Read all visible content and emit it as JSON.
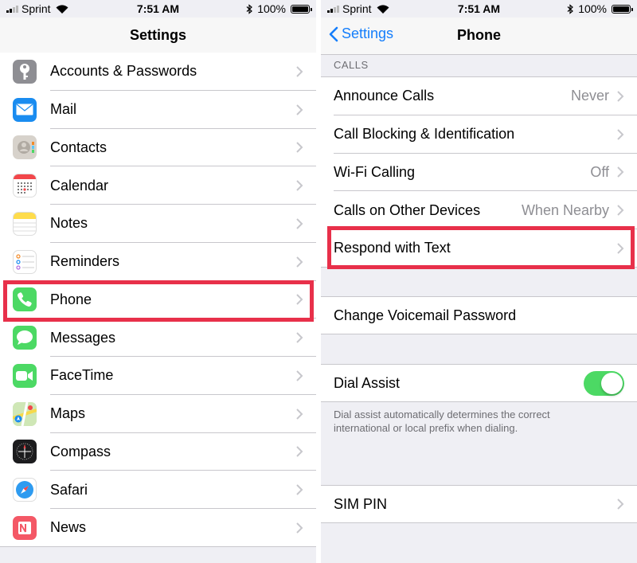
{
  "status_bar": {
    "carrier": "Sprint",
    "time": "7:51 AM",
    "battery": "100%"
  },
  "left": {
    "title": "Settings",
    "items": [
      {
        "label": "Accounts & Passwords",
        "icon": "key-icon",
        "color": "#8e8e93"
      },
      {
        "label": "Mail",
        "icon": "mail-icon",
        "color": "#1a8cf0"
      },
      {
        "label": "Contacts",
        "icon": "contacts-icon",
        "color": "#c9c4bd"
      },
      {
        "label": "Calendar",
        "icon": "calendar-icon",
        "color": "#ffffff"
      },
      {
        "label": "Notes",
        "icon": "notes-icon",
        "color": "#fedc4c"
      },
      {
        "label": "Reminders",
        "icon": "reminders-icon",
        "color": "#ffffff"
      },
      {
        "label": "Phone",
        "icon": "phone-icon",
        "color": "#4cd964"
      },
      {
        "label": "Messages",
        "icon": "messages-icon",
        "color": "#4cd964"
      },
      {
        "label": "FaceTime",
        "icon": "facetime-icon",
        "color": "#4cd964"
      },
      {
        "label": "Maps",
        "icon": "maps-icon",
        "color": "#7dc96d"
      },
      {
        "label": "Compass",
        "icon": "compass-icon",
        "color": "#1c1c1e"
      },
      {
        "label": "Safari",
        "icon": "safari-icon",
        "color": "#ffffff"
      },
      {
        "label": "News",
        "icon": "news-icon",
        "color": "#f45866"
      }
    ]
  },
  "right": {
    "back_label": "Settings",
    "title": "Phone",
    "calls_header": "CALLS",
    "calls": [
      {
        "label": "Announce Calls",
        "value": "Never"
      },
      {
        "label": "Call Blocking & Identification",
        "value": ""
      },
      {
        "label": "Wi-Fi Calling",
        "value": "Off"
      },
      {
        "label": "Calls on Other Devices",
        "value": "When Nearby"
      },
      {
        "label": "Respond with Text",
        "value": ""
      }
    ],
    "voicemail_link": "Change Voicemail Password",
    "dial_assist": {
      "label": "Dial Assist",
      "on": true,
      "footnote_line1": "Dial assist automatically determines the correct",
      "footnote_line2": "international or local prefix when dialing."
    },
    "sim_pin": "SIM PIN"
  },
  "colors": {
    "highlight": "#e8304a",
    "accent": "#157efb",
    "toggle_on": "#4cd964"
  }
}
